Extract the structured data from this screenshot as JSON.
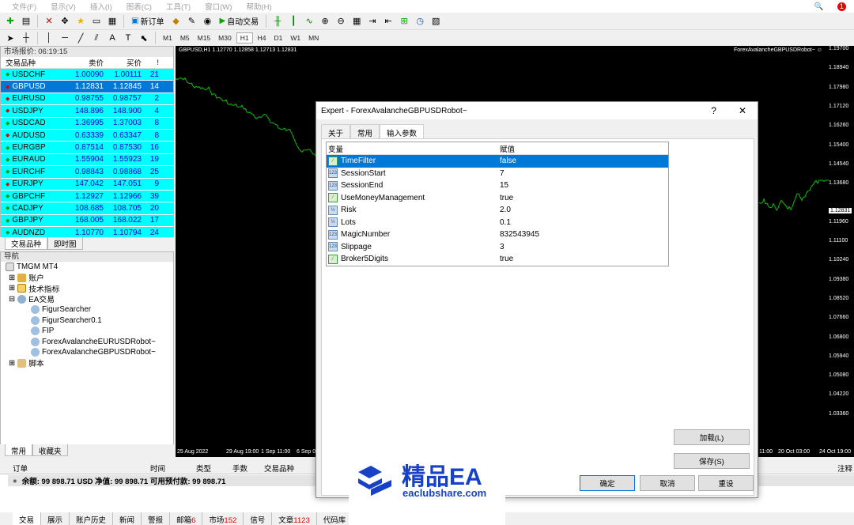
{
  "menu": [
    "文件(F)",
    "显示(V)",
    "插入(I)",
    "图表(C)",
    "工具(T)",
    "窗口(W)",
    "帮助(H)"
  ],
  "menu_right_badge": "1",
  "toolbar": {
    "new_order": "新订单",
    "auto_trade": "自动交易"
  },
  "timeframes": [
    "M1",
    "M5",
    "M15",
    "M30",
    "H1",
    "H4",
    "D1",
    "W1",
    "MN"
  ],
  "market_watch": {
    "title": "市场报价: 06:19:15",
    "headers": {
      "symbol": "交易品种",
      "bid": "卖价",
      "ask": "买价",
      "spread": "!"
    },
    "rows": [
      {
        "symbol": "USDCHF",
        "bid": "1.00090",
        "ask": "1.00111",
        "spread": "21",
        "dir": "up"
      },
      {
        "symbol": "GBPUSD",
        "bid": "1.12831",
        "ask": "1.12845",
        "spread": "14",
        "dir": "dn"
      },
      {
        "symbol": "EURUSD",
        "bid": "0.98755",
        "ask": "0.98757",
        "spread": "2",
        "dir": "dn"
      },
      {
        "symbol": "USDJPY",
        "bid": "148.896",
        "ask": "148.900",
        "spread": "4",
        "dir": "dn"
      },
      {
        "symbol": "USDCAD",
        "bid": "1.36995",
        "ask": "1.37003",
        "spread": "8",
        "dir": "up"
      },
      {
        "symbol": "AUDUSD",
        "bid": "0.63339",
        "ask": "0.63347",
        "spread": "8",
        "dir": "dn"
      },
      {
        "symbol": "EURGBP",
        "bid": "0.87514",
        "ask": "0.87530",
        "spread": "16",
        "dir": "up"
      },
      {
        "symbol": "EURAUD",
        "bid": "1.55904",
        "ask": "1.55923",
        "spread": "19",
        "dir": "up"
      },
      {
        "symbol": "EURCHF",
        "bid": "0.98843",
        "ask": "0.98868",
        "spread": "25",
        "dir": "up"
      },
      {
        "symbol": "EURJPY",
        "bid": "147.042",
        "ask": "147.051",
        "spread": "9",
        "dir": "dn"
      },
      {
        "symbol": "GBPCHF",
        "bid": "1.12927",
        "ask": "1.12966",
        "spread": "39",
        "dir": "up"
      },
      {
        "symbol": "CADJPY",
        "bid": "108.685",
        "ask": "108.705",
        "spread": "20",
        "dir": "up"
      },
      {
        "symbol": "GBPJPY",
        "bid": "168.005",
        "ask": "168.022",
        "spread": "17",
        "dir": "up"
      },
      {
        "symbol": "AUDNZD",
        "bid": "1.10770",
        "ask": "1.10794",
        "spread": "24",
        "dir": "up"
      }
    ],
    "tabs": [
      "交易品种",
      "即时图"
    ]
  },
  "navigator": {
    "title": "导航",
    "root": "TMGM MT4",
    "items": [
      "账户",
      "技术指标",
      "EA交易"
    ],
    "experts": [
      "FigurSearcher",
      "FigurSearcher0.1",
      "FIP",
      "ForexAvalancheEURUSDRobot~",
      "ForexAvalancheGBPUSDRobot~"
    ],
    "scripts": "脚本",
    "tabs": [
      "常用",
      "收藏夹"
    ]
  },
  "chart": {
    "header": "GBPUSD,H1  1.12770 1.12858 1.12713 1.12831",
    "ea_label": "ForexAvalancheGBPUSDRobot~",
    "prices": [
      "1.19700",
      "1.18940",
      "1.17980",
      "1.17120",
      "1.16260",
      "1.15400",
      "1.14540",
      "1.13680",
      "1.12831",
      "1.11960",
      "1.11100",
      "1.10240",
      "1.09380",
      "1.08520",
      "1.07660",
      "1.06800",
      "1.05940",
      "1.05080",
      "1.04220",
      "1.03360"
    ],
    "current_price": "1.12831",
    "dates": [
      "25 Aug 2022",
      "29 Aug 19:00",
      "1 Sep 11:00",
      "6 Sep 0",
      "11:00",
      "20 Oct 03:00",
      "24 Oct 19:00"
    ]
  },
  "dialog": {
    "title": "Expert - ForexAvalancheGBPUSDRobot~",
    "help": "?",
    "close": "✕",
    "tabs": [
      "关于",
      "常用",
      "输入参数"
    ],
    "col_var": "变量",
    "col_val": "赋值",
    "params": [
      {
        "name": "TimeFilter",
        "value": "false",
        "icon": "bool"
      },
      {
        "name": "SessionStart",
        "value": "7",
        "icon": "int"
      },
      {
        "name": "SessionEnd",
        "value": "15",
        "icon": "int"
      },
      {
        "name": "UseMoneyManagement",
        "value": "true",
        "icon": "bool"
      },
      {
        "name": "Risk",
        "value": "2.0",
        "icon": "dbl"
      },
      {
        "name": "Lots",
        "value": "0.1",
        "icon": "dbl"
      },
      {
        "name": "MagicNumber",
        "value": "832543945",
        "icon": "int"
      },
      {
        "name": "Slippage",
        "value": "3",
        "icon": "int"
      },
      {
        "name": "Broker5Digits",
        "value": "true",
        "icon": "bool"
      }
    ],
    "load": "加载(L)",
    "save": "保存(S)",
    "ok": "确定",
    "cancel": "取消",
    "reset": "重设"
  },
  "terminal": {
    "headers": [
      "订单",
      "时间",
      "类型",
      "手数",
      "交易品种",
      "注释"
    ],
    "balance": "余额: 99 898.71 USD  净值: 99 898.71  可用预付款: 99 898.71",
    "tabs": [
      {
        "label": "交易",
        "count": ""
      },
      {
        "label": "展示",
        "count": ""
      },
      {
        "label": "账户历史",
        "count": ""
      },
      {
        "label": "新闻",
        "count": ""
      },
      {
        "label": "警报",
        "count": ""
      },
      {
        "label": "邮箱",
        "count": "6"
      },
      {
        "label": "市场",
        "count": "152"
      },
      {
        "label": "信号",
        "count": ""
      },
      {
        "label": "文章",
        "count": "1123"
      },
      {
        "label": "代码库",
        "count": ""
      }
    ]
  },
  "watermark": {
    "title": "精品EA",
    "url": "eaclubshare.com"
  },
  "colors": {
    "quote_bg": "#00ffff",
    "selected": "#0078d7",
    "bid_text": "#0000d0",
    "chart_bg": "#000000",
    "candle": "#00c000",
    "brand": "#1742c8"
  }
}
